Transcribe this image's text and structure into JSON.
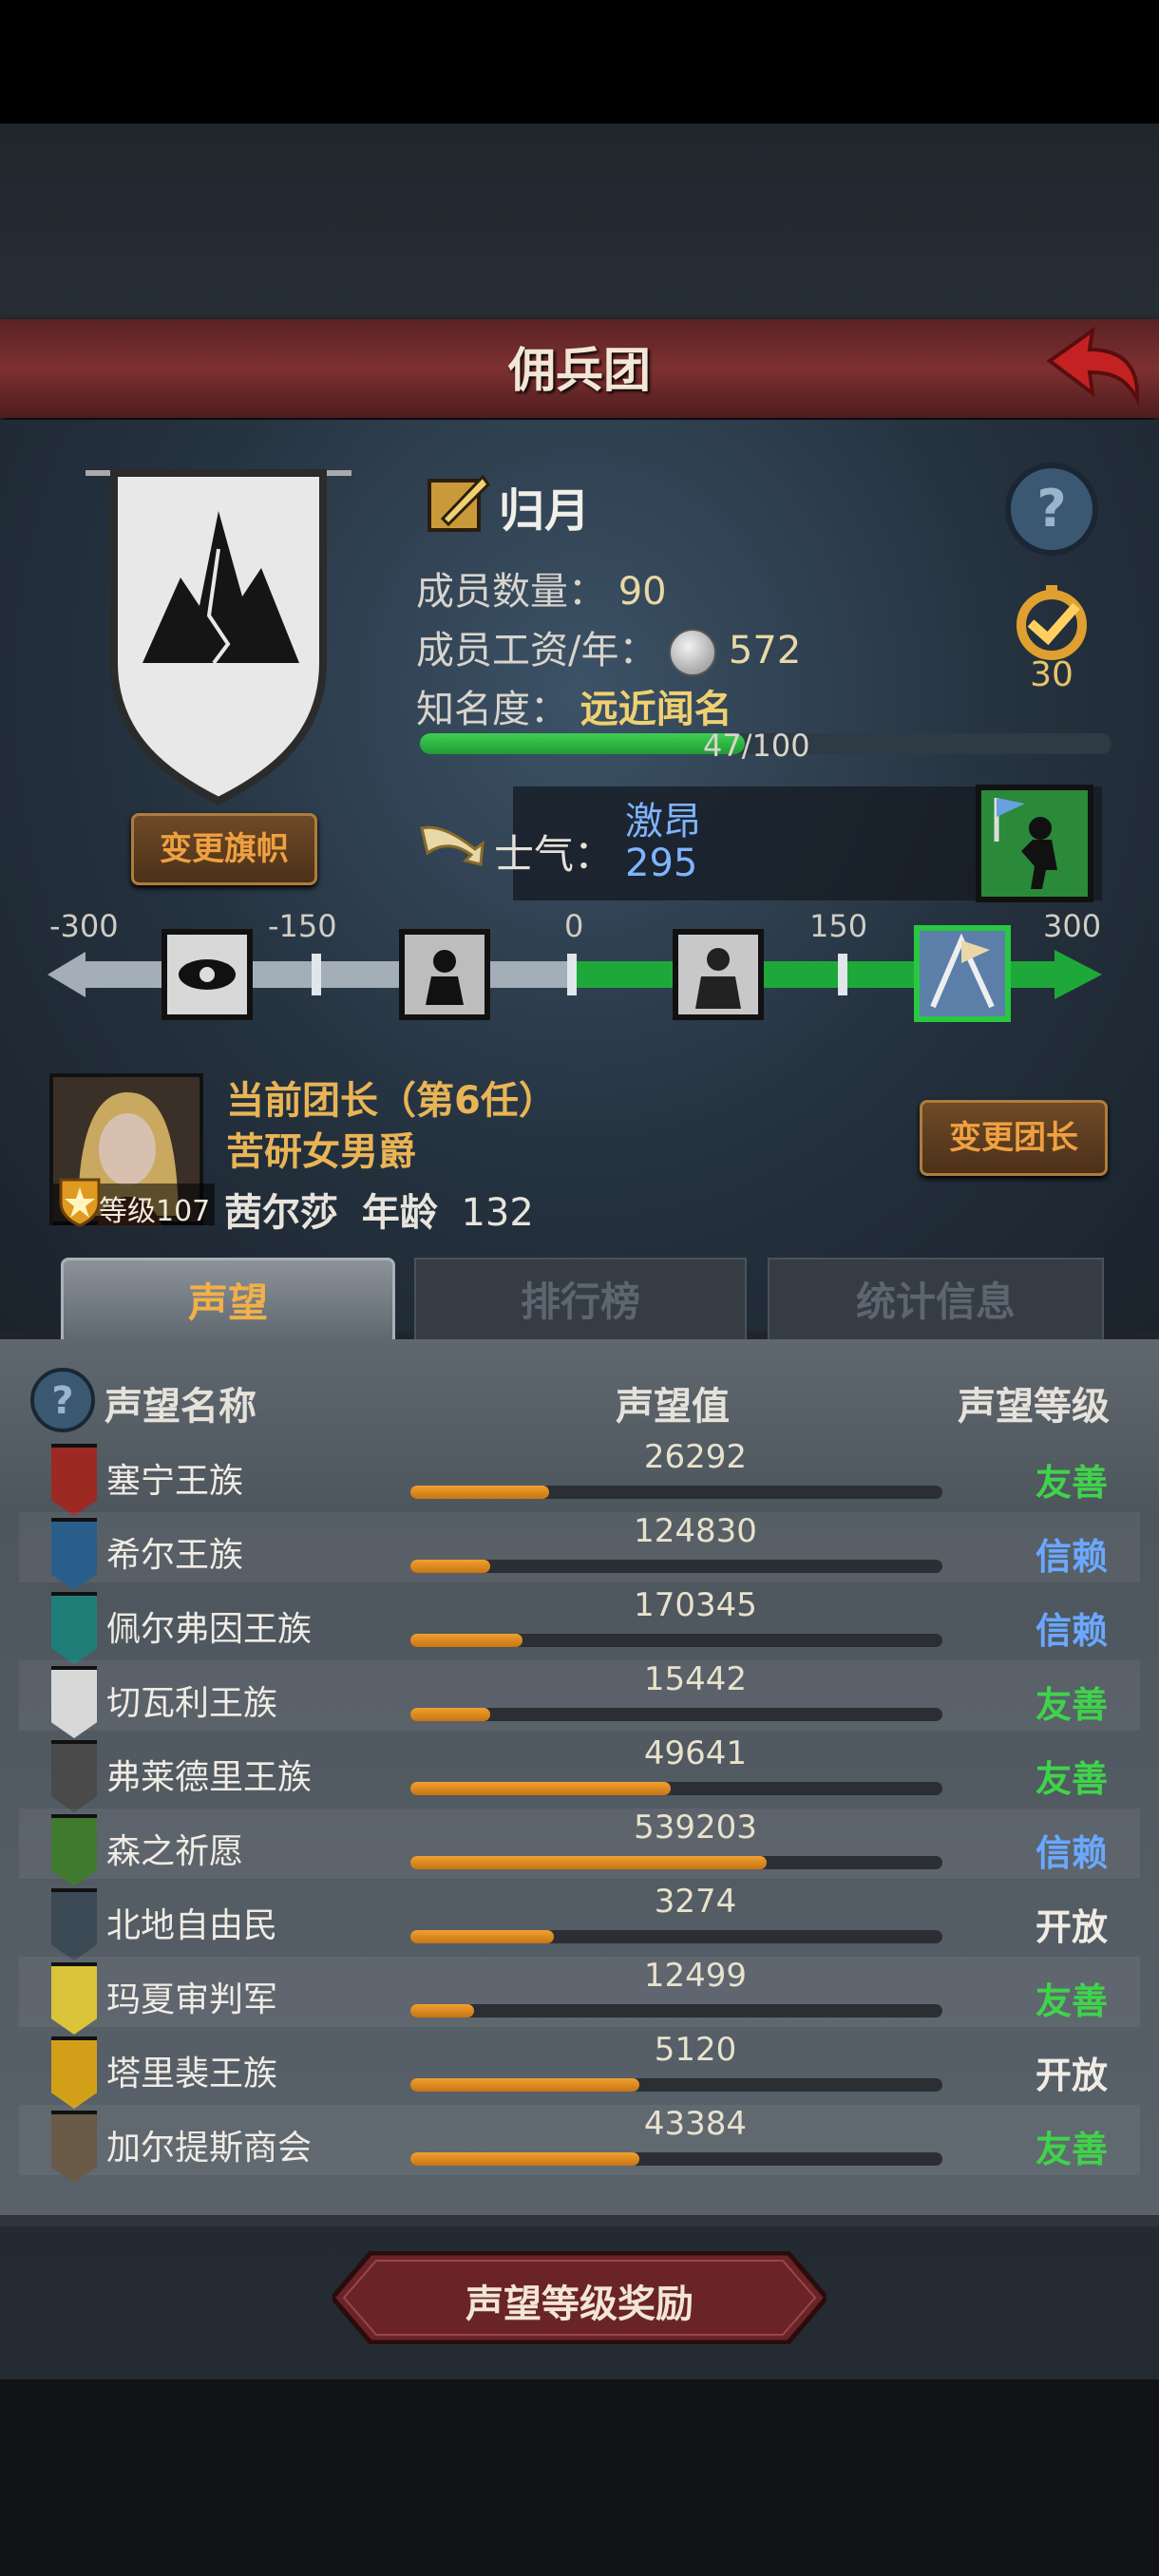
{
  "header": {
    "title": "佣兵团"
  },
  "guild": {
    "name": "归月",
    "members_label": "成员数量：",
    "members_value": "90",
    "wage_label": "成员工资/年：",
    "wage_value": "572",
    "fame_label": "知名度：",
    "fame_value": "远近闻名",
    "fame_progress": "47/100",
    "fame_fraction": 0.47,
    "medal_value": "30",
    "change_banner": "变更旗帜"
  },
  "morale": {
    "label": "士气：",
    "name": "激昂",
    "value": "295",
    "scale_labels": [
      "-300",
      "-150",
      "0",
      "150",
      "300"
    ]
  },
  "leader": {
    "line1": "当前团长（第6任）",
    "title": "苦研女男爵",
    "name": "茜尔莎",
    "age_label": "年龄",
    "age": "132",
    "level": "等级107",
    "change_button": "变更团长"
  },
  "tabs": {
    "reputation": "声望",
    "ranking": "排行榜",
    "stats": "统计信息"
  },
  "table": {
    "col_name": "声望名称",
    "col_value": "声望值",
    "col_level": "声望等级",
    "rows": [
      {
        "name": "塞宁王族",
        "value": "26292",
        "level": "友善",
        "fill": 0.26,
        "color": "#9c2a22"
      },
      {
        "name": "希尔王族",
        "value": "124830",
        "level": "信赖",
        "fill": 0.15,
        "color": "#2a5e8a"
      },
      {
        "name": "佩尔弗因王族",
        "value": "170345",
        "level": "信赖",
        "fill": 0.21,
        "color": "#1f7f78"
      },
      {
        "name": "切瓦利王族",
        "value": "15442",
        "level": "友善",
        "fill": 0.15,
        "color": "#d8d8d8"
      },
      {
        "name": "弗莱德里王族",
        "value": "49641",
        "level": "友善",
        "fill": 0.49,
        "color": "#4a4a4a"
      },
      {
        "name": "森之祈愿",
        "value": "539203",
        "level": "信赖",
        "fill": 0.67,
        "color": "#3f7a2f"
      },
      {
        "name": "北地自由民",
        "value": "3274",
        "level": "开放",
        "fill": 0.27,
        "color": "#3b4a55"
      },
      {
        "name": "玛夏审判军",
        "value": "12499",
        "level": "友善",
        "fill": 0.12,
        "color": "#d9c43a"
      },
      {
        "name": "塔里裴王族",
        "value": "5120",
        "level": "开放",
        "fill": 0.43,
        "color": "#d2a018"
      },
      {
        "name": "加尔提斯商会",
        "value": "43384",
        "level": "友善",
        "fill": 0.43,
        "color": "#6a5a48"
      }
    ],
    "level_colors": {
      "友善": "#3fd34a",
      "信赖": "#6aa8ff",
      "开放": "#f0ece4"
    }
  },
  "reward_button": "声望等级奖励"
}
